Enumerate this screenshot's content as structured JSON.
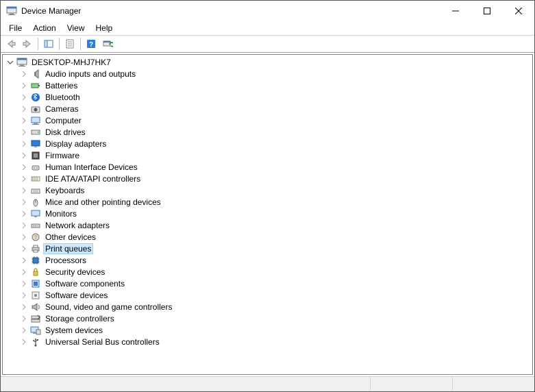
{
  "window": {
    "title": "Device Manager"
  },
  "menu": {
    "file": "File",
    "action": "Action",
    "view": "View",
    "help": "Help"
  },
  "tree": {
    "root": "DESKTOP-MHJ7HK7",
    "items": [
      {
        "label": "Audio inputs and outputs",
        "icon": "audio"
      },
      {
        "label": "Batteries",
        "icon": "battery"
      },
      {
        "label": "Bluetooth",
        "icon": "bluetooth"
      },
      {
        "label": "Cameras",
        "icon": "camera"
      },
      {
        "label": "Computer",
        "icon": "computer"
      },
      {
        "label": "Disk drives",
        "icon": "disk"
      },
      {
        "label": "Display adapters",
        "icon": "display"
      },
      {
        "label": "Firmware",
        "icon": "firmware"
      },
      {
        "label": "Human Interface Devices",
        "icon": "hid"
      },
      {
        "label": "IDE ATA/ATAPI controllers",
        "icon": "ide"
      },
      {
        "label": "Keyboards",
        "icon": "keyboard"
      },
      {
        "label": "Mice and other pointing devices",
        "icon": "mouse"
      },
      {
        "label": "Monitors",
        "icon": "monitor"
      },
      {
        "label": "Network adapters",
        "icon": "network"
      },
      {
        "label": "Other devices",
        "icon": "other"
      },
      {
        "label": "Print queues",
        "icon": "printer",
        "selected": true
      },
      {
        "label": "Processors",
        "icon": "processor"
      },
      {
        "label": "Security devices",
        "icon": "security"
      },
      {
        "label": "Software components",
        "icon": "component"
      },
      {
        "label": "Software devices",
        "icon": "softdev"
      },
      {
        "label": "Sound, video and game controllers",
        "icon": "sound"
      },
      {
        "label": "Storage controllers",
        "icon": "storage"
      },
      {
        "label": "System devices",
        "icon": "system"
      },
      {
        "label": "Universal Serial Bus controllers",
        "icon": "usb"
      }
    ]
  },
  "statusbar": {
    "cells": [
      "",
      "",
      ""
    ]
  }
}
